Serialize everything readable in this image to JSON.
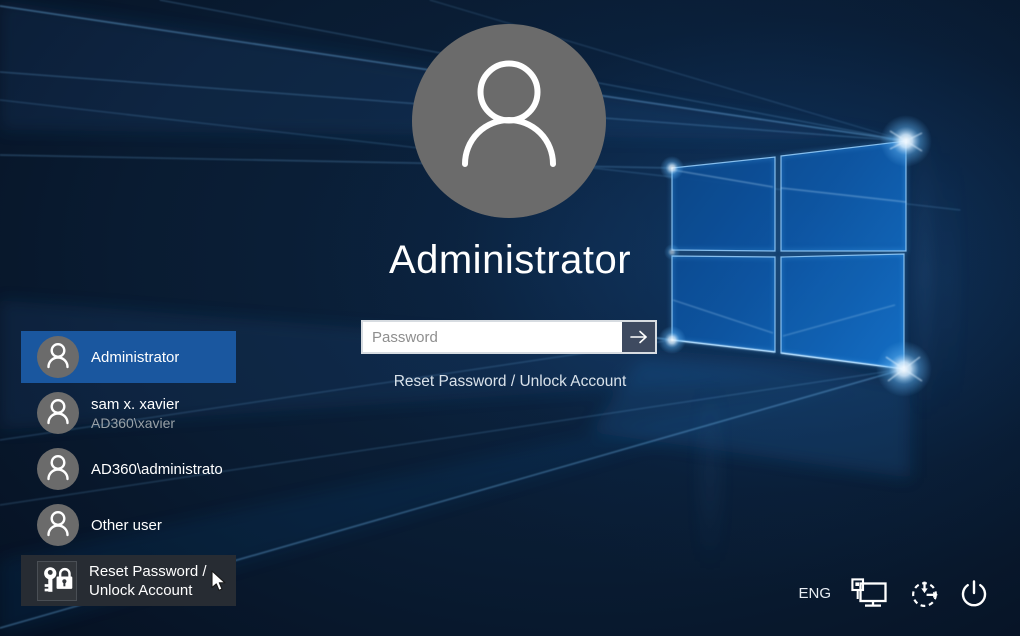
{
  "session": {
    "user_display_name": "Administrator",
    "password_placeholder": "Password",
    "reset_link_label": "Reset Password / Unlock Account"
  },
  "user_list": {
    "items": [
      {
        "label": "Administrator",
        "state": "selected"
      },
      {
        "label": "sam x. xavier",
        "sublabel": "AD360\\xavier"
      },
      {
        "label": "AD360\\administrato"
      },
      {
        "label": "Other user"
      },
      {
        "label_line1": "Reset Password /",
        "label_line2": "Unlock Account",
        "icon": "key-lock-icon",
        "state": "hover"
      }
    ]
  },
  "status_bar": {
    "language_label": "ENG",
    "icons": [
      "network-icon",
      "ease-of-access-icon",
      "power-icon"
    ]
  },
  "colors": {
    "selected_row_bg": "#1a579f",
    "hover_row_bg": "#272c33",
    "avatar_gray": "#6b6b6b",
    "submit_button_bg": "#3e4a60",
    "background_base": "#081a30"
  }
}
